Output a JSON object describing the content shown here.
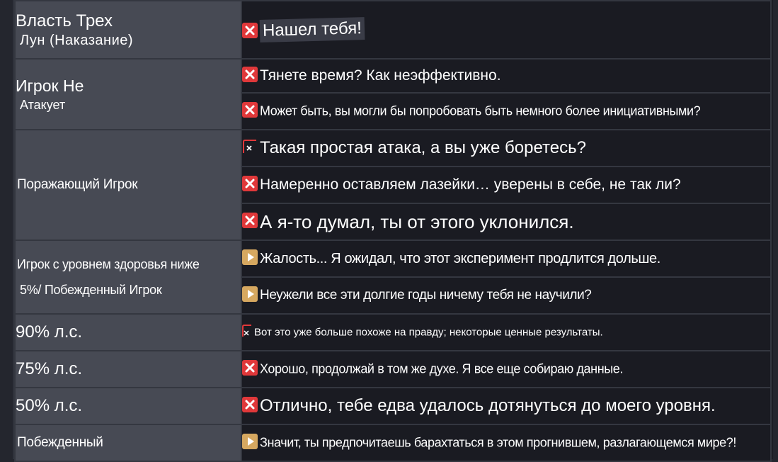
{
  "colors": {
    "label_bg": "#474a54",
    "line_bg": "#1a1b22",
    "border": "#343740",
    "red_icon": "#e0383a",
    "play_icon": "#d6a860"
  },
  "rows": [
    {
      "label_lines": [
        "Власть Трех",
        "Лун (Наказание)"
      ],
      "lines": [
        {
          "icon": "red-x-icon",
          "text": "Нашел тебя!"
        }
      ]
    },
    {
      "label_lines": [
        "Игрок Не",
        "Атакует"
      ],
      "lines": [
        {
          "icon": "red-x-icon",
          "text": "Тянете время? Как неэффективно."
        },
        {
          "icon": "red-x-icon",
          "text": "Может быть, вы могли бы попробовать быть немного более инициативными?"
        }
      ]
    },
    {
      "label_lines": [
        "Поражающий Игрок"
      ],
      "lines": [
        {
          "icon": "broken-icon",
          "text": "Такая простая атака, а вы уже боретесь?"
        },
        {
          "icon": "red-x-icon",
          "text": "Намеренно оставляем лазейки… уверены в себе, не так ли?"
        },
        {
          "icon": "red-x-icon",
          "text": "А я-то думал, ты от этого уклонился."
        }
      ]
    },
    {
      "label_lines": [
        "Игрок с уровнем здоровья ниже",
        "5%/ Побежденный Игрок"
      ],
      "lines": [
        {
          "icon": "play-icon",
          "text": "Жалость... Я ожидал, что этот эксперимент продлится дольше."
        },
        {
          "icon": "play-icon",
          "text": "Неужели все эти долгие годы ничему тебя не научили?"
        }
      ]
    },
    {
      "label_lines": [
        "90% л.с."
      ],
      "lines": [
        {
          "icon": "broken-icon",
          "text": "Вот это уже больше похоже на правду; некоторые ценные результаты."
        }
      ]
    },
    {
      "label_lines": [
        "75% л.с."
      ],
      "lines": [
        {
          "icon": "red-x-icon",
          "text": "Хорошо, продолжай в том же духе. Я все еще собираю данные."
        }
      ]
    },
    {
      "label_lines": [
        "50% л.с."
      ],
      "lines": [
        {
          "icon": "red-x-icon",
          "text": "Отлично, тебе едва удалось дотянуться до моего уровня."
        }
      ]
    },
    {
      "label_lines": [
        "Побежденный"
      ],
      "lines": [
        {
          "icon": "play-icon",
          "text": "Значит, ты предпочитаешь барахтаться в этом прогнившем, разлагающемся мире?!"
        }
      ]
    }
  ]
}
